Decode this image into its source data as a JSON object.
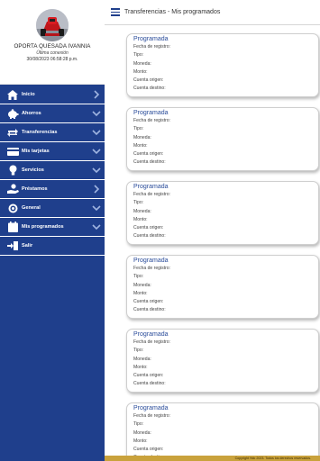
{
  "profile": {
    "name": "OPORTA QUESADA IVANNIA",
    "last_connection_label": "Última conexión",
    "last_connection_date": "30/08/2023 06:58:28 p.m."
  },
  "menu": [
    {
      "label": "Inicio",
      "icon": "home-icon",
      "arrow": "right"
    },
    {
      "label": "Ahorros",
      "icon": "piggy-bank-icon",
      "arrow": "down"
    },
    {
      "label": "Transferencias",
      "icon": "transfer-icon",
      "arrow": "down"
    },
    {
      "label": "Mis tarjetas",
      "icon": "card-icon",
      "arrow": "down"
    },
    {
      "label": "Servicios",
      "icon": "lightbulb-icon",
      "arrow": "down"
    },
    {
      "label": "Préstamos",
      "icon": "loan-icon",
      "arrow": "right"
    },
    {
      "label": "General",
      "icon": "target-icon",
      "arrow": "down"
    },
    {
      "label": "Mis programados",
      "icon": "calendar-icon",
      "arrow": "down"
    },
    {
      "label": "Salir",
      "icon": "logout-icon",
      "arrow": ""
    }
  ],
  "header": {
    "title": "Transferencias - Mis programados"
  },
  "card_labels": {
    "title": "Programada",
    "fecha": "Fecha de registro:",
    "tipo": "Tipo:",
    "moneda": "Moneda:",
    "monto": "Monto:",
    "origen": "Cuenta origen:",
    "destino": "Cuenta destino:"
  },
  "footer": {
    "text": "Copyright Hdc 2023. Todos los derechos reservados."
  },
  "colors": {
    "menu_bg": "#1f3f8c",
    "accent_title": "#2a4c9a",
    "footer_bg": "#c9a23c"
  }
}
